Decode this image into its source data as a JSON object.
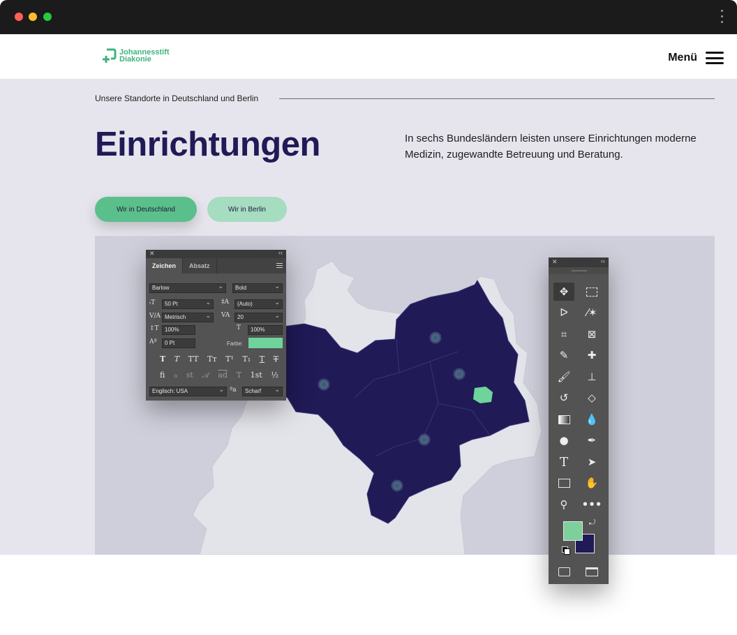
{
  "site": {
    "logo_line1": "Johannesstift",
    "logo_line2": "Diakonie",
    "menu_label": "Menü"
  },
  "hero": {
    "kicker": "Unsere Standorte in Deutschland und Berlin",
    "title": "Einrichtungen",
    "lead": "In sechs Bundesländern leisten unsere Einrichtungen moderne Medizin, zugewandte Betreuung und Beratung.",
    "buttons": [
      {
        "label": "Wir in Deutschland",
        "active": true
      },
      {
        "label": "Wir in Berlin",
        "active": false
      }
    ]
  },
  "colors": {
    "brand_green": "#5bbf8c",
    "brand_navy": "#201a56",
    "map_region": "#201a56",
    "map_land": "#e3e3ea",
    "berlin": "#6fd39c",
    "pin": "#3f5c78"
  },
  "character_panel": {
    "tabs": [
      "Zeichen",
      "Absatz"
    ],
    "font_family": "Barlow",
    "font_style": "Bold",
    "font_size": "50 Pt",
    "leading": "(Auto)",
    "kerning": "Metrisch",
    "tracking": "20",
    "vertical_scale": "100%",
    "horizontal_scale": "100%",
    "baseline_shift": "0 Pt",
    "color_label": "Farbe:",
    "language": "Englisch: USA",
    "antialias_label": "ªa",
    "antialias": "Scharf",
    "style_glyphs": [
      "T",
      "T",
      "TT",
      "Tт",
      "T¹",
      "T₁",
      "T",
      "T"
    ],
    "opentype_glyphs": [
      "fi",
      "ℴ",
      "st",
      "𝒜",
      "ad",
      "T",
      "1st",
      "½"
    ]
  },
  "tools_panel": {
    "tools": [
      "move-icon",
      "marquee-icon",
      "lasso-icon",
      "magic-wand-icon",
      "crop-icon",
      "frame-icon",
      "eyedropper-icon",
      "healing-brush-icon",
      "brush-icon",
      "stamp-icon",
      "history-brush-icon",
      "eraser-icon",
      "gradient-icon",
      "blur-icon",
      "dodge-icon",
      "pen-icon",
      "type-icon",
      "path-select-icon",
      "rectangle-icon",
      "hand-icon",
      "zoom-icon",
      "more-icon"
    ],
    "foreground_color": "#7dcf9c",
    "background_color": "#201a56"
  }
}
